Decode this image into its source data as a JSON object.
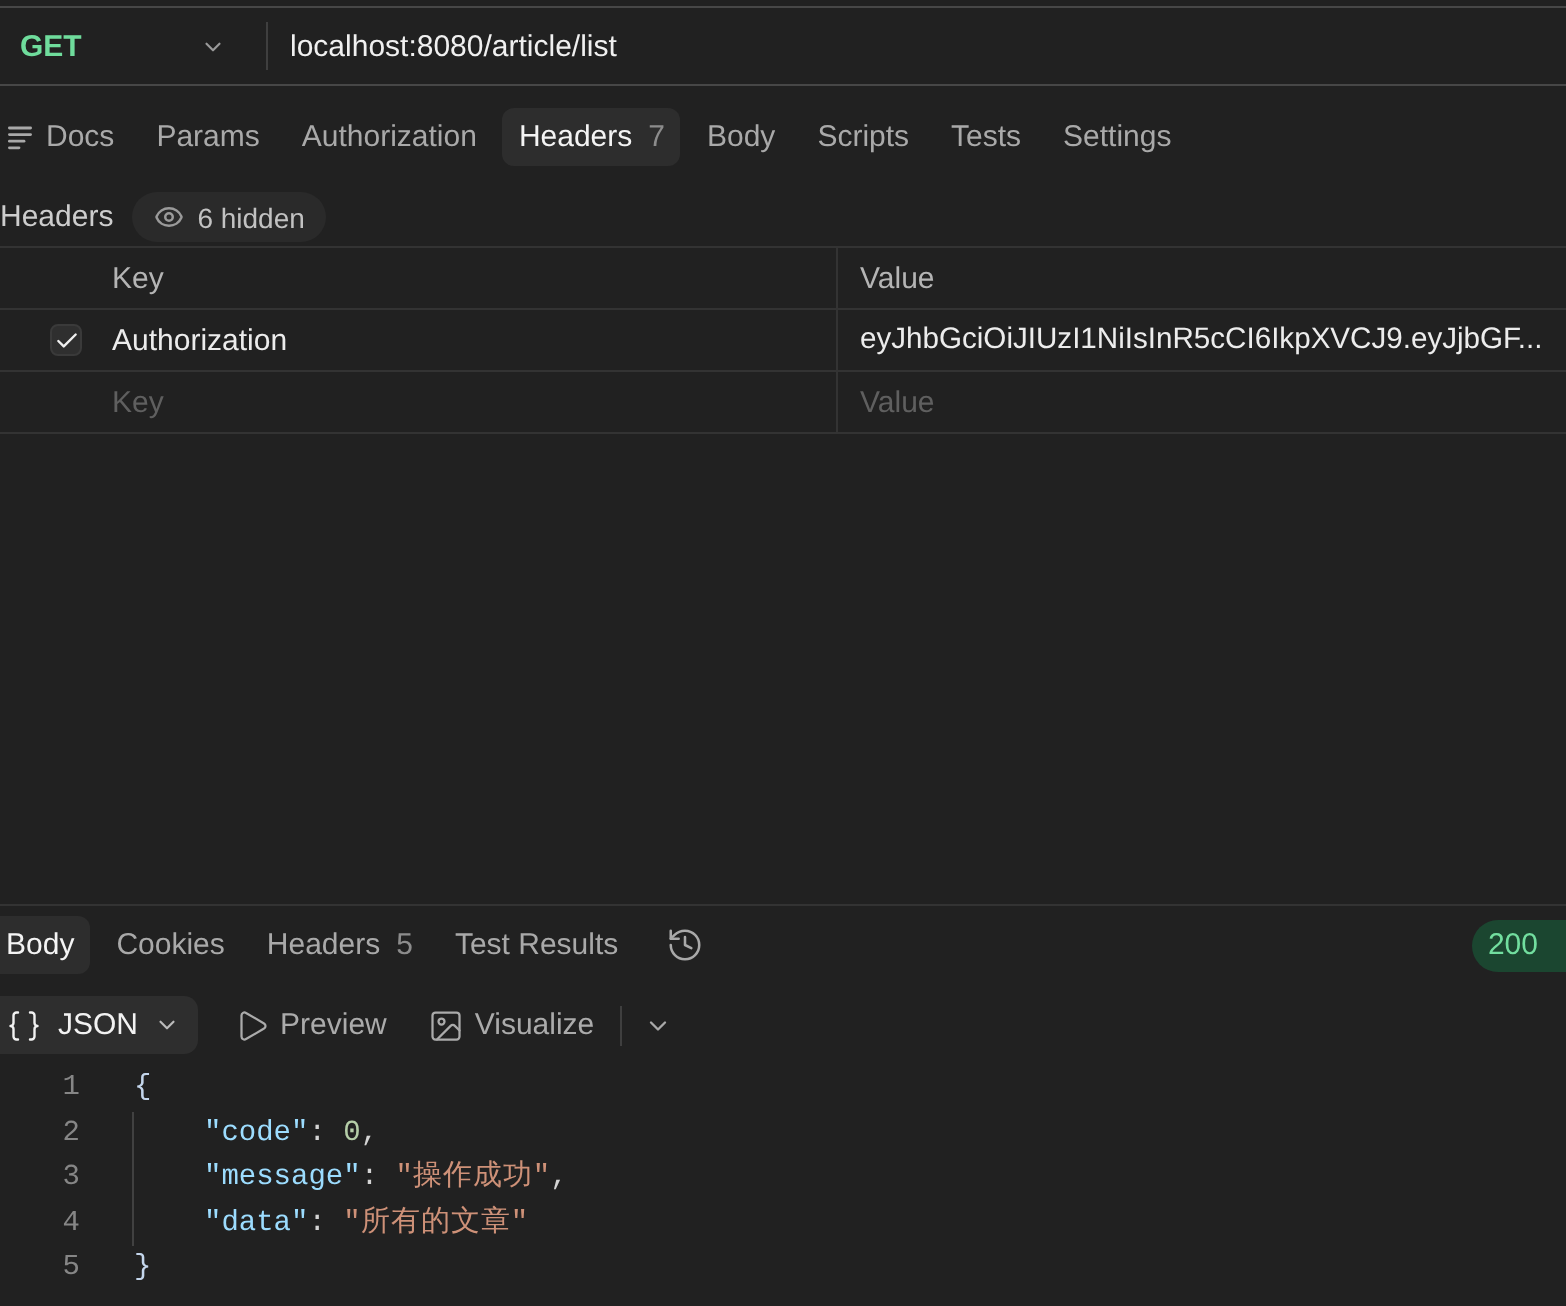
{
  "request": {
    "method": "GET",
    "url": "localhost:8080/article/list"
  },
  "request_tabs": [
    {
      "label": "Docs",
      "kind": "docs",
      "selected": false
    },
    {
      "label": "Params",
      "kind": "plain",
      "selected": false
    },
    {
      "label": "Authorization",
      "kind": "plain",
      "selected": false
    },
    {
      "label": "Headers",
      "kind": "plain",
      "count": "7",
      "selected": true
    },
    {
      "label": "Body",
      "kind": "plain",
      "selected": false
    },
    {
      "label": "Scripts",
      "kind": "plain",
      "selected": false
    },
    {
      "label": "Tests",
      "kind": "plain",
      "selected": false
    },
    {
      "label": "Settings",
      "kind": "plain",
      "selected": false
    }
  ],
  "headers": {
    "title": "Headers",
    "hidden_badge": "6 hidden",
    "columns": [
      "Key",
      "Value"
    ],
    "rows": [
      {
        "checked": true,
        "key": "Authorization",
        "value": "eyJhbGciOiJIUzI1NiIsInR5cCI6IkpXVCJ9.eyJjbGF..."
      }
    ],
    "new_row": {
      "key_placeholder": "Key",
      "value_placeholder": "Value"
    }
  },
  "response": {
    "tabs": [
      {
        "label": "Body",
        "selected": true
      },
      {
        "label": "Cookies",
        "selected": false
      },
      {
        "label": "Headers",
        "count": "5",
        "selected": false
      },
      {
        "label": "Test Results",
        "selected": false
      }
    ],
    "status": "200",
    "format": "JSON",
    "views": [
      {
        "label": "Preview",
        "kind": "preview"
      },
      {
        "label": "Visualize",
        "kind": "visualize"
      }
    ],
    "code_lines": [
      {
        "number": "1",
        "indented": false,
        "tokens": [
          {
            "kind": "brace",
            "text": "{"
          }
        ]
      },
      {
        "number": "2",
        "indented": true,
        "tokens": [
          {
            "kind": "key",
            "text": "\"code\""
          },
          {
            "kind": "punct",
            "text": ": "
          },
          {
            "kind": "number",
            "text": "0"
          },
          {
            "kind": "punct",
            "text": ","
          }
        ]
      },
      {
        "number": "3",
        "indented": true,
        "tokens": [
          {
            "kind": "key",
            "text": "\"message\""
          },
          {
            "kind": "punct",
            "text": ": "
          },
          {
            "kind": "string",
            "text": "\"操作成功\""
          },
          {
            "kind": "punct",
            "text": ","
          }
        ]
      },
      {
        "number": "4",
        "indented": true,
        "tokens": [
          {
            "kind": "key",
            "text": "\"data\""
          },
          {
            "kind": "punct",
            "text": ": "
          },
          {
            "kind": "string",
            "text": "\"所有的文章\""
          }
        ]
      },
      {
        "number": "5",
        "indented": false,
        "tokens": [
          {
            "kind": "brace",
            "text": "}"
          }
        ]
      }
    ]
  }
}
